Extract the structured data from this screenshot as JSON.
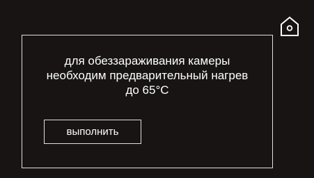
{
  "header": {
    "home_icon": "home-icon"
  },
  "dialog": {
    "message_lines": [
      "для обеззараживания камеры",
      "необходим предварительный нагрев",
      "до 65°С"
    ],
    "execute_label": "выполнить"
  },
  "colors": {
    "background": "#171413",
    "foreground": "#ffffff",
    "border": "#e0e0e0"
  }
}
